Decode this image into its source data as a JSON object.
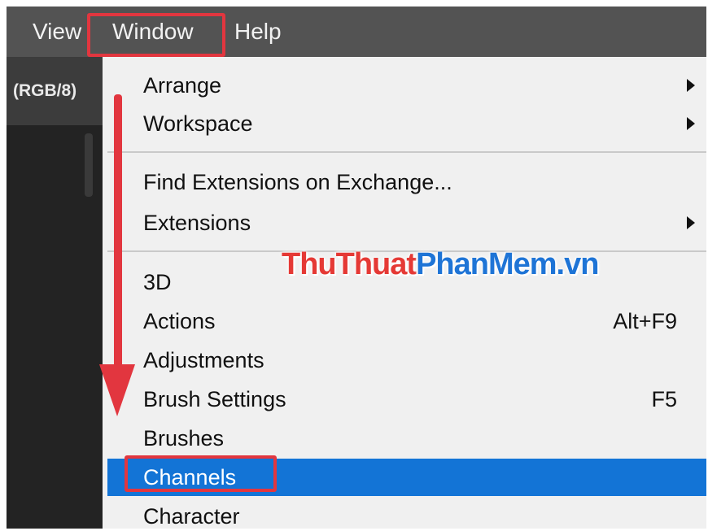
{
  "menubar": {
    "items": [
      {
        "label": "View"
      },
      {
        "label": "Window"
      },
      {
        "label": "Help"
      }
    ]
  },
  "document": {
    "tab_label": "(RGB/8)"
  },
  "window_menu": {
    "items": [
      {
        "label": "Arrange",
        "submenu": true
      },
      {
        "label": "Workspace",
        "submenu": true
      },
      {
        "label": "Find Extensions on Exchange..."
      },
      {
        "label": "Extensions",
        "submenu": true
      },
      {
        "label": "3D"
      },
      {
        "label": "Actions",
        "shortcut": "Alt+F9"
      },
      {
        "label": "Adjustments"
      },
      {
        "label": "Brush Settings",
        "shortcut": "F5"
      },
      {
        "label": "Brushes"
      },
      {
        "label": "Channels",
        "selected": true
      },
      {
        "label": "Character"
      }
    ]
  },
  "watermark": {
    "part1": "ThuThuat",
    "part2": "PhanMem.vn"
  },
  "colors": {
    "menubar": "#535353",
    "dropdown": "#f0f0f0",
    "selection": "#1374d6",
    "annotation_red": "#e2363f",
    "watermark_red": "#e53935",
    "watermark_blue": "#1e74d6"
  },
  "icons": {
    "submenu": "chevron-right-icon",
    "annotation": "down-arrow-icon"
  }
}
